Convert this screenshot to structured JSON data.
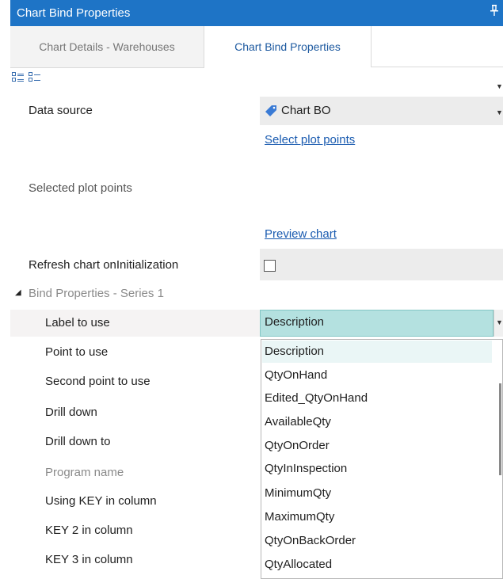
{
  "window": {
    "title": "Chart Bind Properties",
    "pin_glyph": "⬇"
  },
  "tabs": [
    {
      "label": "Chart Details - Warehouses",
      "active": false
    },
    {
      "label": "Chart Bind Properties",
      "active": true
    }
  ],
  "toolbar": {
    "icons": [
      "categorized-view-icon",
      "alphabetical-view-icon"
    ]
  },
  "properties": {
    "data_source": {
      "label": "Data source",
      "value": "Chart BO"
    },
    "select_plot_points_link": "Select plot points",
    "selected_plot_points": {
      "label": "Selected plot points"
    },
    "preview_chart_link": "Preview chart",
    "refresh_chart": {
      "label": "Refresh chart onInitialization",
      "checked": false
    },
    "group": {
      "label": "Bind Properties - Series 1",
      "expanded": true
    },
    "series": [
      {
        "label": "Label to use",
        "value": "Description"
      },
      {
        "label": "Point to use"
      },
      {
        "label": "Second point to use"
      },
      {
        "label": "Drill down"
      },
      {
        "label": "Drill down to"
      },
      {
        "label": "Program name"
      },
      {
        "label": "Using KEY in column"
      },
      {
        "label": "KEY 2 in column"
      },
      {
        "label": "KEY 3 in column"
      }
    ]
  },
  "dropdown": {
    "selected": "Description",
    "options": [
      "Description",
      "QtyOnHand",
      "Edited_QtyOnHand",
      "AvailableQty",
      "QtyOnOrder",
      "QtyInInspection",
      "MinimumQty",
      "MaximumQty",
      "QtyOnBackOrder",
      "QtyAllocated"
    ]
  },
  "colors": {
    "title_bar": "#1e74c6",
    "active_tab_text": "#1e5aa0",
    "link": "#1a5bb0",
    "dropdown_selected": "#b4e1e0"
  }
}
